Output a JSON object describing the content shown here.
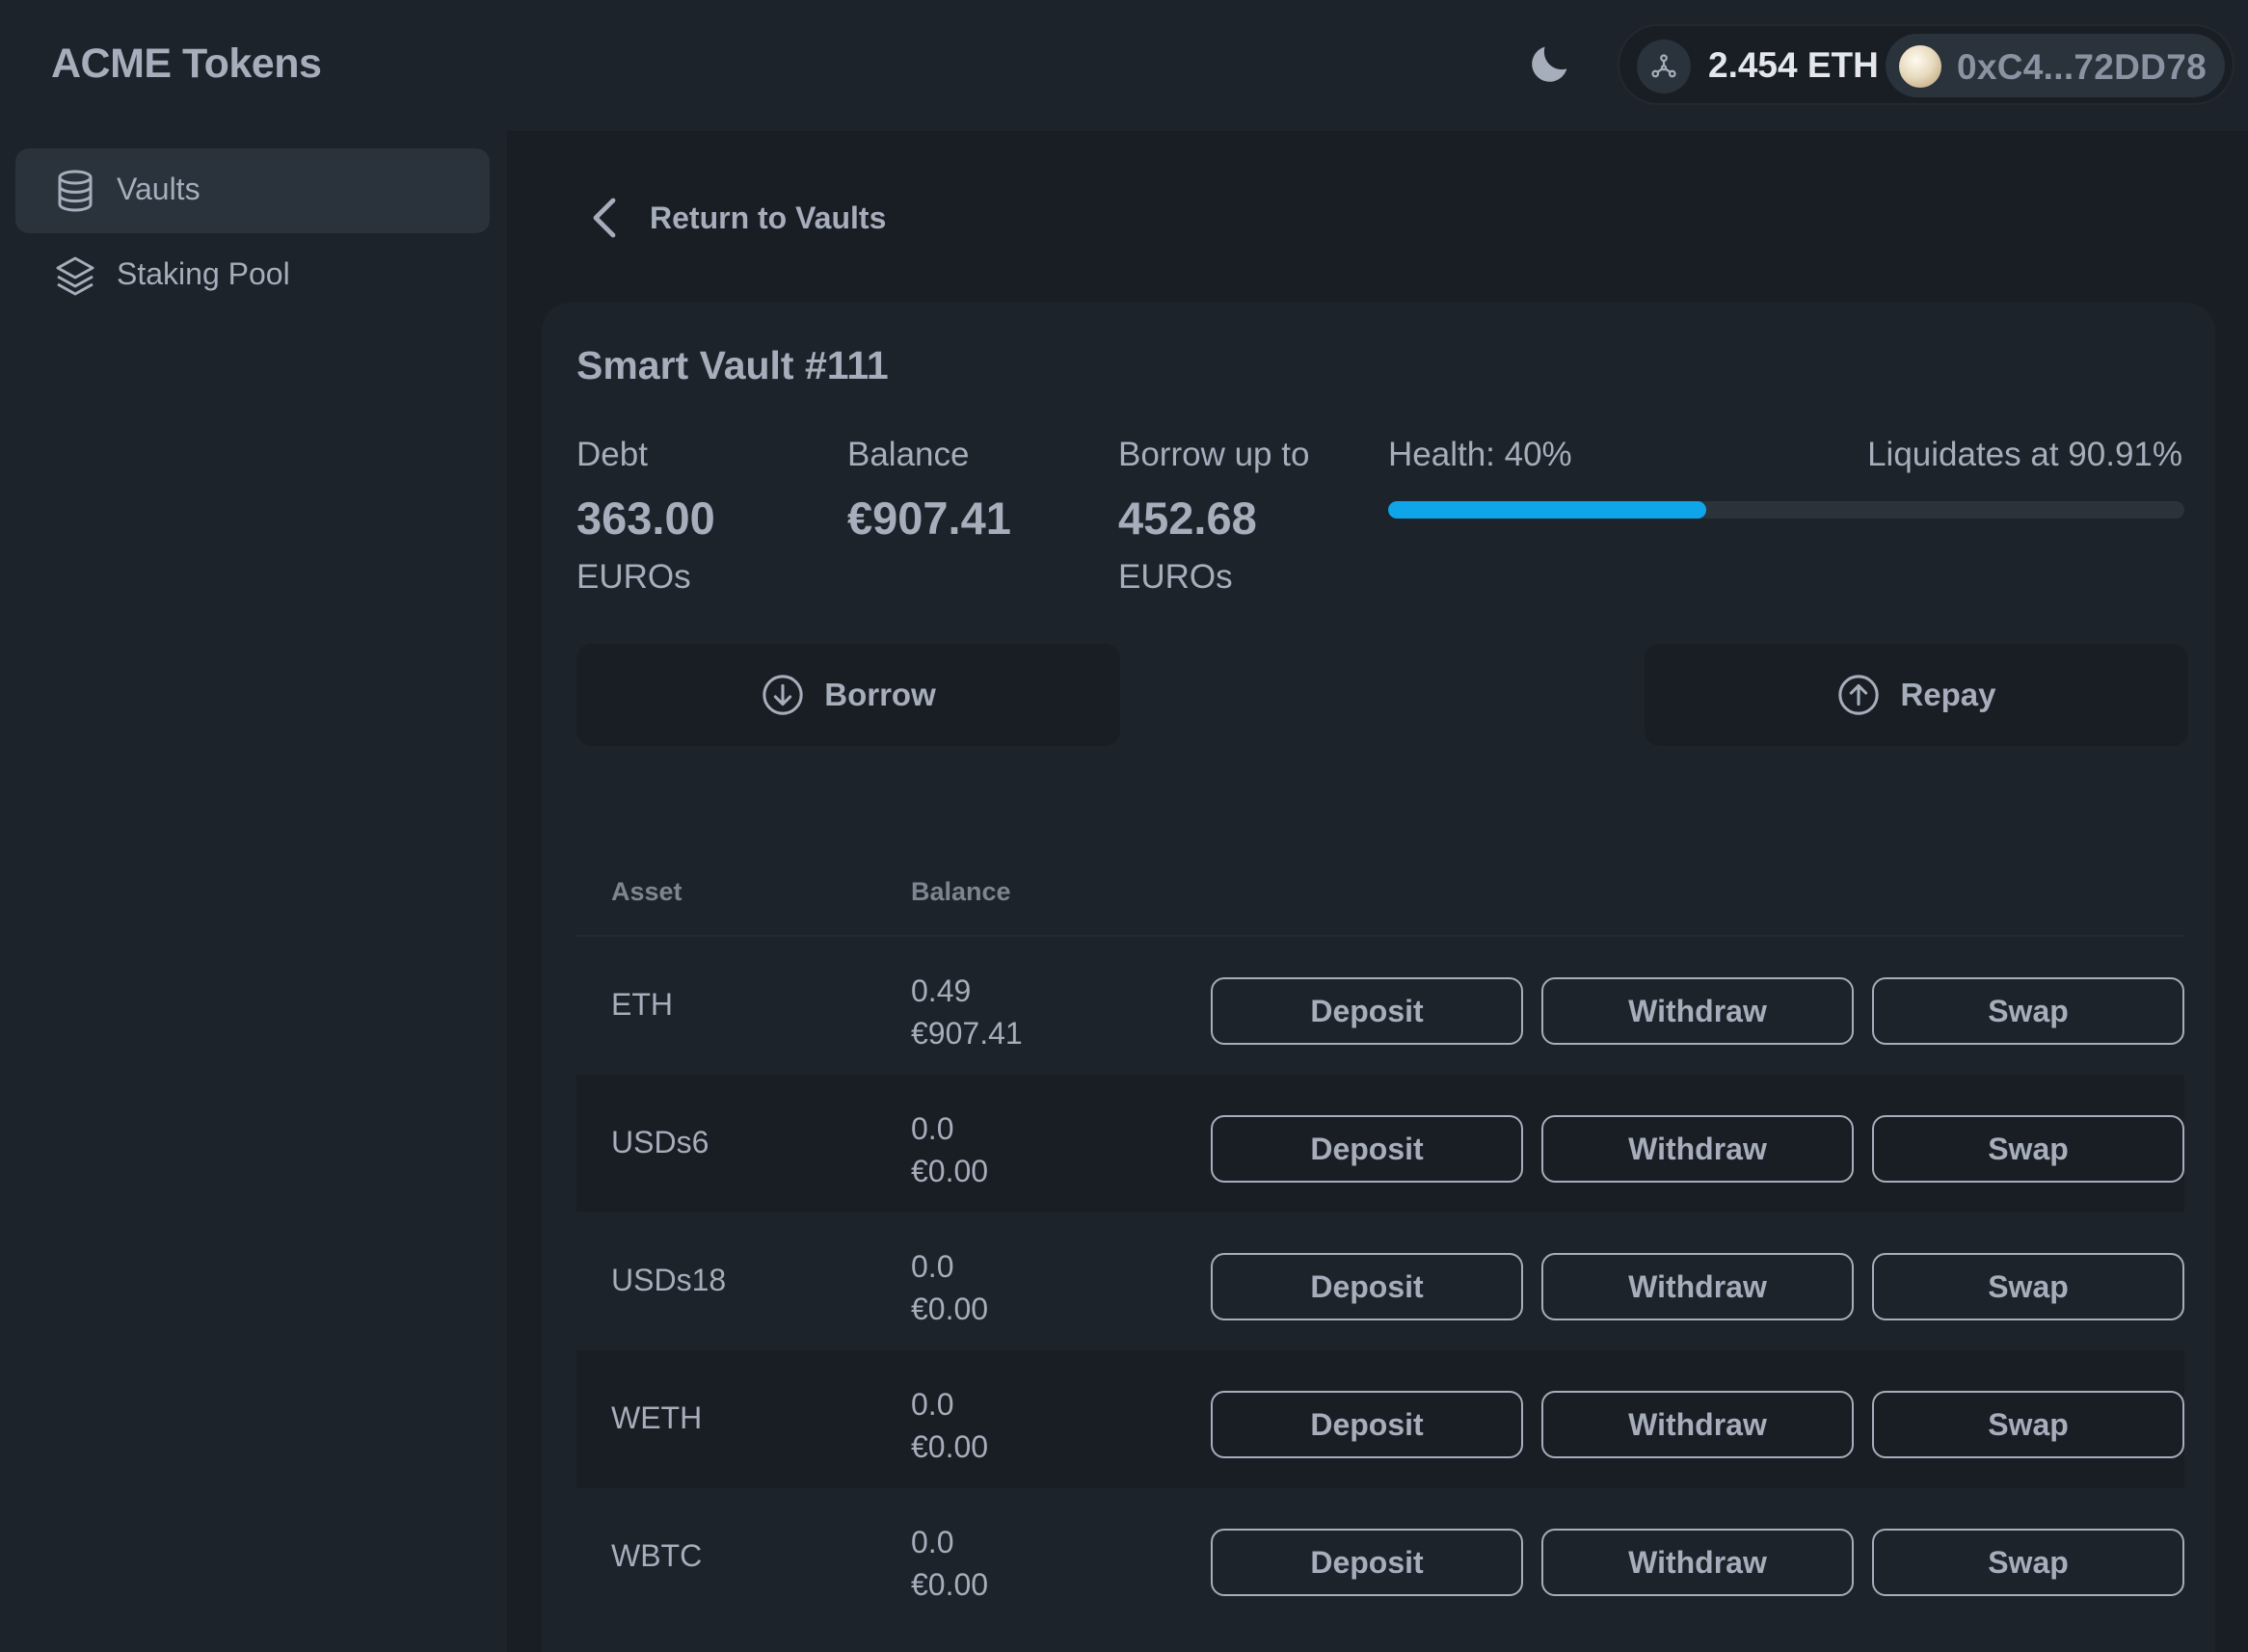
{
  "header": {
    "brand": "ACME Tokens",
    "theme_icon": "moon-icon",
    "network_icon": "network-nodes-icon",
    "eth_balance": "2.454 ETH",
    "account_address": "0xC4...72DD78"
  },
  "sidebar": {
    "items": [
      {
        "label": "Vaults",
        "icon": "database-stack-icon",
        "active": true
      },
      {
        "label": "Staking Pool",
        "icon": "layers-icon",
        "active": false
      }
    ]
  },
  "main": {
    "back_label": "Return to Vaults",
    "vault": {
      "title": "Smart Vault #111",
      "debt_label": "Debt",
      "debt_value": "363.00",
      "debt_unit": "EUROs",
      "balance_label": "Balance",
      "balance_value": "€907.41",
      "borrow_label": "Borrow up to",
      "borrow_value": "452.68",
      "borrow_unit": "EUROs",
      "health_label": "Health: 40%",
      "health_fraction": 0.4,
      "liquidates_label": "Liquidates at 90.91%",
      "borrow_button": "Borrow",
      "repay_button": "Repay"
    },
    "assets_table": {
      "headers": {
        "asset": "Asset",
        "balance": "Balance"
      },
      "rows": [
        {
          "asset": "ETH",
          "amount": "0.49",
          "value": "€907.41",
          "deposit": "Deposit",
          "withdraw": "Withdraw",
          "swap": "Swap"
        },
        {
          "asset": "USDs6",
          "amount": "0.0",
          "value": "€0.00",
          "deposit": "Deposit",
          "withdraw": "Withdraw",
          "swap": "Swap"
        },
        {
          "asset": "USDs18",
          "amount": "0.0",
          "value": "€0.00",
          "deposit": "Deposit",
          "withdraw": "Withdraw",
          "swap": "Swap"
        },
        {
          "asset": "WETH",
          "amount": "0.0",
          "value": "€0.00",
          "deposit": "Deposit",
          "withdraw": "Withdraw",
          "swap": "Swap"
        },
        {
          "asset": "WBTC",
          "amount": "0.0",
          "value": "€0.00",
          "deposit": "Deposit",
          "withdraw": "Withdraw",
          "swap": "Swap"
        }
      ]
    }
  },
  "colors": {
    "background": "#1d232a",
    "panel": "#191e24",
    "text": "#a6adbb",
    "accent": "#0ea5e9"
  }
}
